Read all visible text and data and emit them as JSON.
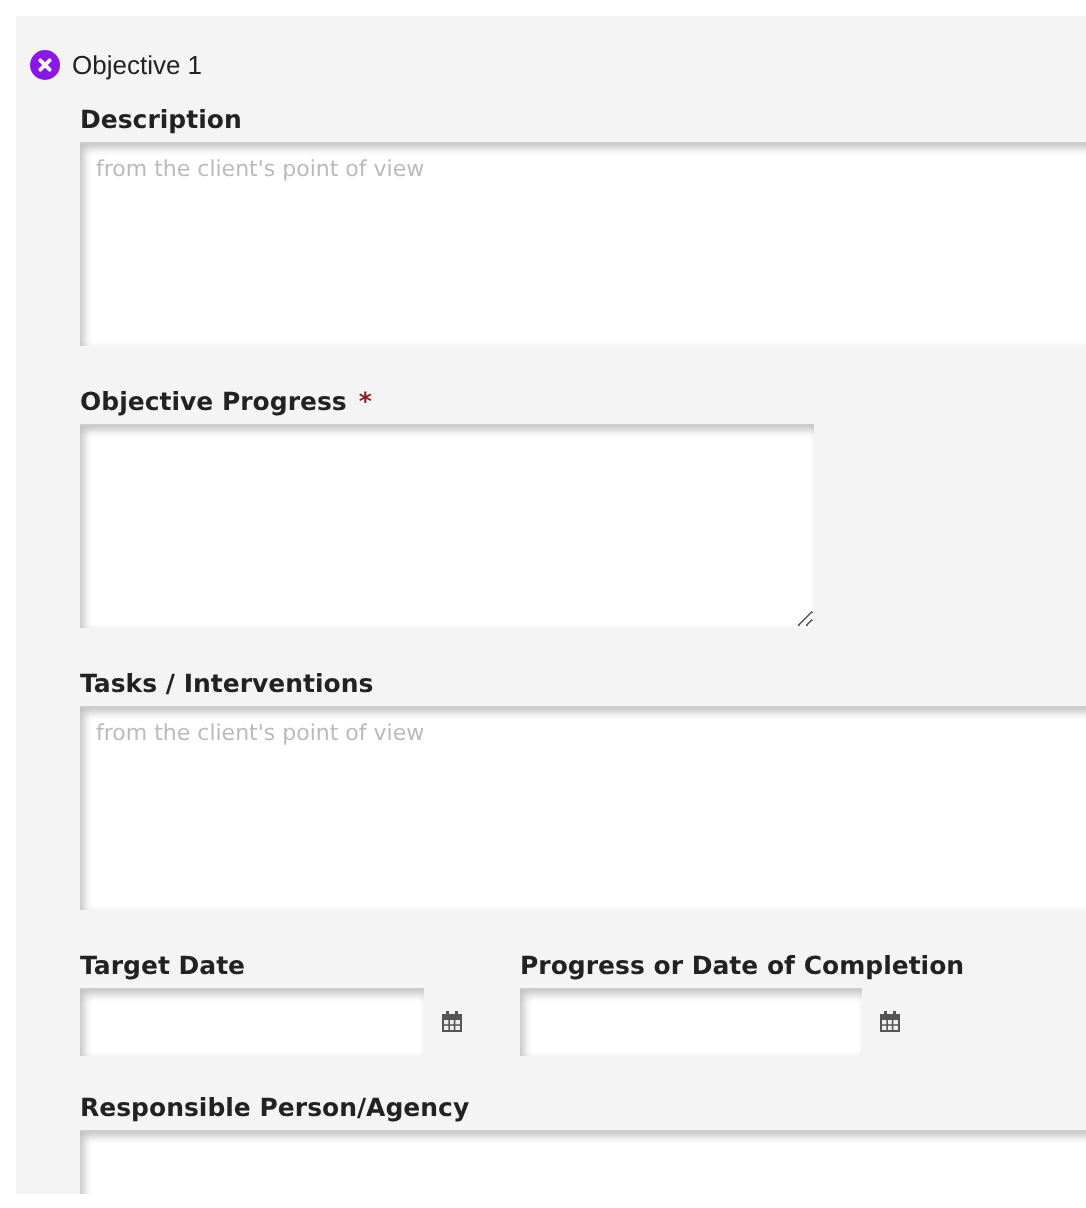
{
  "objective": {
    "title": "Objective 1"
  },
  "fields": [
    {
      "kind": "textarea",
      "label": "Description",
      "placeholder": "from the client's point of view",
      "required": false,
      "wide": true
    },
    {
      "kind": "textarea",
      "label": "Objective Progress",
      "required": true,
      "wide": false
    },
    {
      "kind": "textarea",
      "label": "Tasks / Interventions",
      "placeholder": "from the client's point of view",
      "required": false,
      "wide": true
    }
  ],
  "dates": [
    {
      "label": "Target Date"
    },
    {
      "label": "Progress or Date of Completion"
    }
  ],
  "responsible": {
    "label": "Responsible Person/Agency"
  },
  "required_mark": "*"
}
